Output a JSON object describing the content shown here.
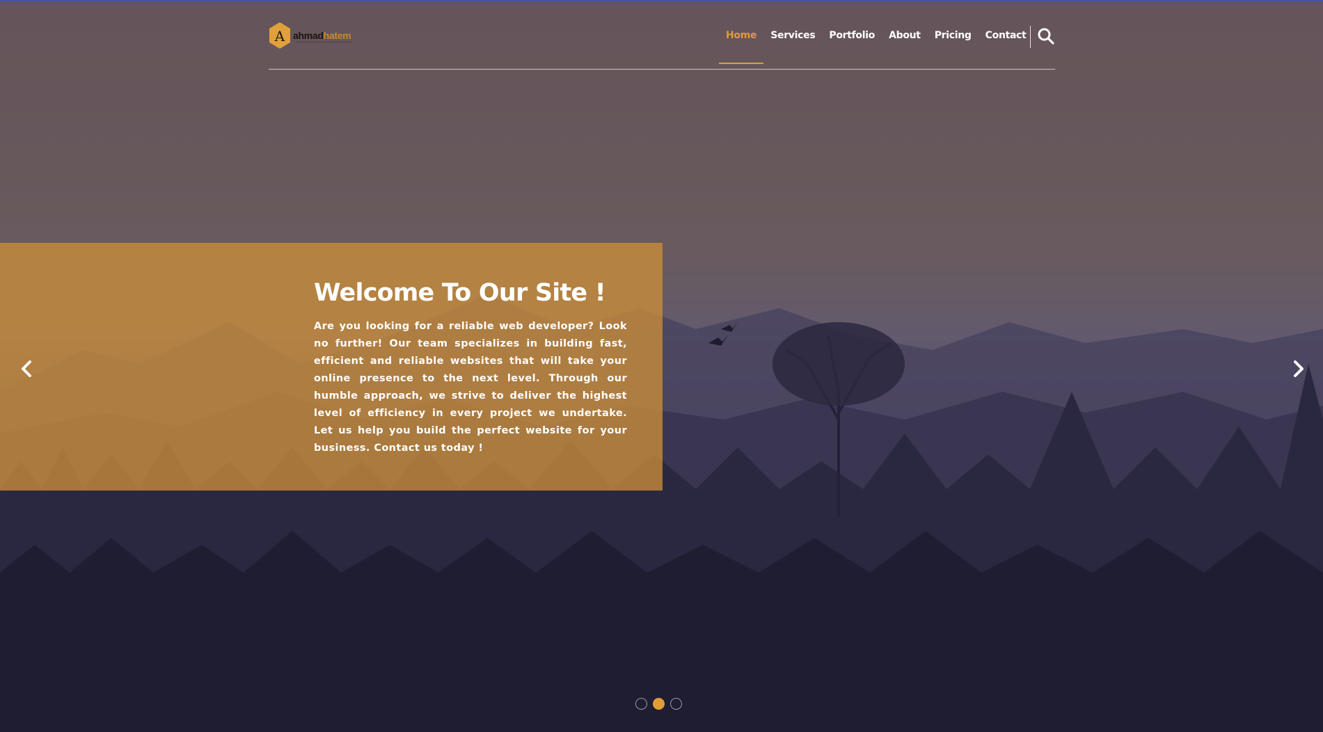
{
  "brand": {
    "logo_letter": "A",
    "logo_first": "ahmad",
    "logo_second": "hatem",
    "accent_color": "#e29c35"
  },
  "nav": {
    "items": [
      {
        "label": "Home",
        "active": true
      },
      {
        "label": "Services",
        "active": false
      },
      {
        "label": "Portfolio",
        "active": false
      },
      {
        "label": "About",
        "active": false
      },
      {
        "label": "Pricing",
        "active": false
      },
      {
        "label": "Contact",
        "active": false
      }
    ],
    "search_icon": "search-icon"
  },
  "slider": {
    "title": "Welcome To Our Site !",
    "text": "Are you looking for a reliable web developer? Look no further! Our team specializes in building fast, efficient and reliable websites that will take your online presence to the next level. Through our humble approach, we strive to deliver the highest level of efficiency in every project we undertake. Let us help you build the perfect website for your business. Contact us today !",
    "prev_icon": "chevron-left-icon",
    "next_icon": "chevron-right-icon",
    "dot_count": 3,
    "active_dot": 1
  }
}
